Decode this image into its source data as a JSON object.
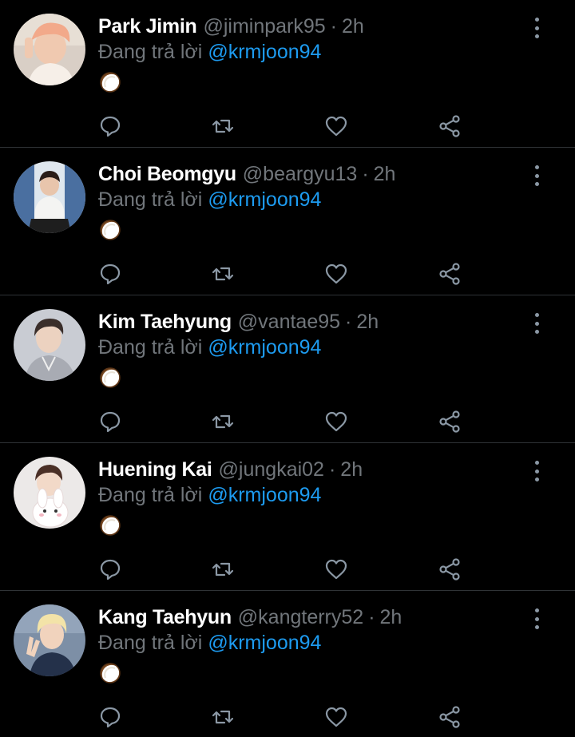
{
  "colors": {
    "background": "#000000",
    "name": "#ffffff",
    "muted": "#71767b",
    "mention": "#1d9bf0",
    "divider": "#2f3336",
    "icon": "#8b98a5"
  },
  "tweets": [
    {
      "name": "Park Jimin",
      "handle": "@jiminpark95",
      "separator": "·",
      "time": "2h",
      "reply_prefix": "Đang trả lời",
      "reply_to": "@krmjoon94",
      "content_icon": "coconut-emoji",
      "avatar_icon": "profile-photo"
    },
    {
      "name": "Choi Beomgyu",
      "handle": "@beargyu13",
      "separator": "·",
      "time": "2h",
      "reply_prefix": "Đang trả lời",
      "reply_to": "@krmjoon94",
      "content_icon": "coconut-emoji",
      "avatar_icon": "profile-photo"
    },
    {
      "name": "Kim Taehyung",
      "handle": "@vantae95",
      "separator": "·",
      "time": "2h",
      "reply_prefix": "Đang trả lời",
      "reply_to": "@krmjoon94",
      "content_icon": "coconut-emoji",
      "avatar_icon": "profile-photo"
    },
    {
      "name": "Huening Kai",
      "handle": "@jungkai02",
      "separator": "·",
      "time": "2h",
      "reply_prefix": "Đang trả lời",
      "reply_to": "@krmjoon94",
      "content_icon": "coconut-emoji",
      "avatar_icon": "profile-photo"
    },
    {
      "name": "Kang Taehyun",
      "handle": "@kangterry52",
      "separator": "·",
      "time": "2h",
      "reply_prefix": "Đang trả lời",
      "reply_to": "@krmjoon94",
      "content_icon": "coconut-emoji",
      "avatar_icon": "profile-photo"
    }
  ],
  "action_icons": [
    "reply-icon",
    "retweet-icon",
    "like-icon",
    "share-icon"
  ]
}
